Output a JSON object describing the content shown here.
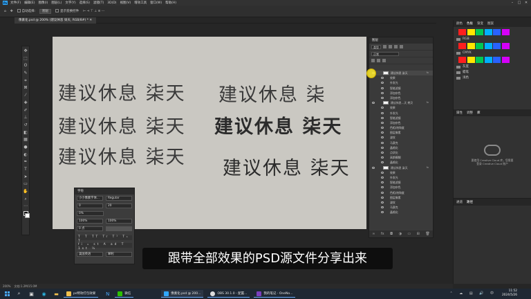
{
  "menubar": {
    "logo": "Ps",
    "items": [
      "文件(F)",
      "编辑(E)",
      "图像(I)",
      "图层(L)",
      "文字(Y)",
      "选择(S)",
      "滤镜(T)",
      "3D(D)",
      "视图(V)",
      "增效工具",
      "窗口(W)",
      "帮助(H)"
    ]
  },
  "optionsbar": {
    "auto_select": "自动选择:",
    "target": "图层",
    "show_transform": "显示变换控件"
  },
  "document": {
    "tab_title": "像素化.psd @ 200% (建议休息 柒天, RGB/8#) *"
  },
  "canvas": {
    "rows": [
      "建议休息 柒天",
      "建议休息 柒",
      "建议休息 柒天",
      "建议休息 柒天",
      "建议休息 柒天",
      "建议休息 柒天"
    ]
  },
  "character_panel": {
    "title": "字符",
    "font": "小小像素字体...",
    "style": "Regular",
    "size": "0",
    "leading": "20",
    "tracking": "0%",
    "vscale": "100%",
    "hscale": "100%",
    "baseline": "0 点",
    "lang": "美国英语",
    "aa": "犀利"
  },
  "layers_panel": {
    "title": "图层",
    "kind": "类型",
    "mode": "正常",
    "items": [
      {
        "label": "建议休息 柒天",
        "kind": "top"
      },
      {
        "label": "效果",
        "kind": "eff"
      },
      {
        "label": "外发光",
        "kind": "eff"
      },
      {
        "label": "智能滤镜",
        "kind": "eff"
      },
      {
        "label": "添加杂色",
        "kind": "eff"
      },
      {
        "label": "添加杂色",
        "kind": "eff"
      },
      {
        "label": "建议休息...天 拷贝",
        "kind": "layer"
      },
      {
        "label": "效果",
        "kind": "eff"
      },
      {
        "label": "外发光",
        "kind": "eff"
      },
      {
        "label": "智能滤镜",
        "kind": "eff"
      },
      {
        "label": "添加杂色",
        "kind": "eff"
      },
      {
        "label": "色相/饱和度",
        "kind": "eff"
      },
      {
        "label": "图层像素",
        "kind": "eff"
      },
      {
        "label": "波纹",
        "kind": "eff"
      },
      {
        "label": "马赛克",
        "kind": "eff"
      },
      {
        "label": "晶格化",
        "kind": "eff"
      },
      {
        "label": "点状化",
        "kind": "eff"
      },
      {
        "label": "高斯模糊",
        "kind": "eff"
      },
      {
        "label": "晶格化",
        "kind": "eff"
      },
      {
        "label": "建议休息 柒天",
        "kind": "layer"
      },
      {
        "label": "效果",
        "kind": "eff"
      },
      {
        "label": "外发光",
        "kind": "eff"
      },
      {
        "label": "智能滤镜",
        "kind": "eff"
      },
      {
        "label": "添加杂色",
        "kind": "eff"
      },
      {
        "label": "色相/饱和度",
        "kind": "eff"
      },
      {
        "label": "图层像素",
        "kind": "eff"
      },
      {
        "label": "波纹",
        "kind": "eff"
      },
      {
        "label": "马赛克",
        "kind": "eff"
      },
      {
        "label": "晶格化",
        "kind": "eff"
      }
    ]
  },
  "right_panel": {
    "tabs": [
      "颜色",
      "色板",
      "渐变",
      "图案"
    ],
    "groups": [
      "RGB",
      "CMYK",
      "灰度",
      "蜡笔",
      "浅色"
    ],
    "cc_text": [
      "要使用 Creative Cloud 库，您需要",
      "登录 Creative Cloud 账户"
    ],
    "sub_tabs": [
      "属性",
      "调整",
      "库"
    ],
    "bottom_tabs": [
      "通道",
      "路径"
    ]
  },
  "status": {
    "zoom": "200%",
    "info": "文档:1.2M/15.0M"
  },
  "subtitle": "跟带全部效果的PSD源文件分享出来",
  "taskbar": {
    "apps": [
      "ps特效打包效果",
      "微信",
      "像素化.psd @ 200...",
      "OBS 30.1.0 - 配置...",
      "我的笔记 - OneNo..."
    ]
  },
  "clock": {
    "time": "11:52",
    "date": "2024/5/26"
  },
  "colors": {
    "swatches1": [
      "#ff1e1e",
      "#ffe600",
      "#00c853",
      "#00b0ff",
      "#2962ff",
      "#d500f9"
    ],
    "swatches2": [
      "#ff1e1e",
      "#ffe600",
      "#00c853",
      "#00b0ff",
      "#2962ff",
      "#d500f9"
    ]
  }
}
